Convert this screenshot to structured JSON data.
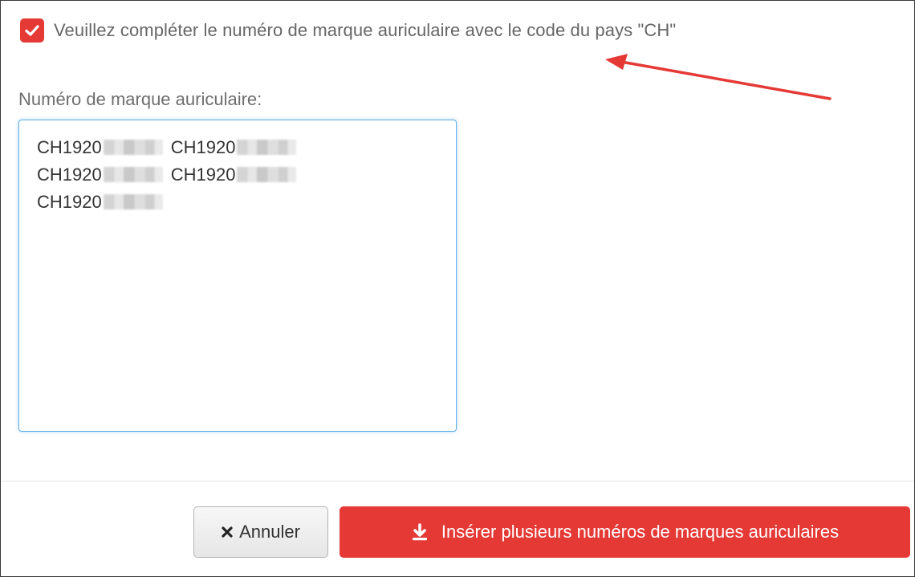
{
  "dialog": {
    "checkbox": {
      "checked": true,
      "label": "Veuillez compléter le numéro de marque auriculaire avec le code du pays \"CH\"",
      "color": "#e53935"
    },
    "field_label": "Numéro de marque auriculaire:",
    "ear_tags": [
      [
        "CH1920",
        "CH1920"
      ],
      [
        "CH1920",
        "CH1920"
      ],
      [
        "CH1920"
      ]
    ],
    "buttons": {
      "cancel_label": "Annuler",
      "cancel_icon": "times-icon",
      "insert_label": "Insérer plusieurs numéros de marques auriculaires",
      "insert_icon": "download-icon",
      "insert_color": "#e53935"
    },
    "annotation": {
      "arrow_color": "#e53935"
    }
  }
}
